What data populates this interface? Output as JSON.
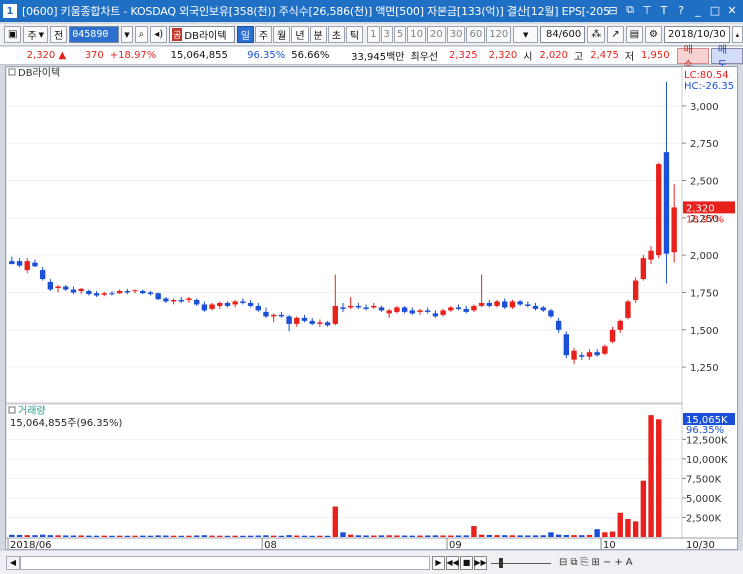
{
  "titlebar": {
    "number": "1",
    "title": "[0600] 키움종합차트 - KOSDAQ 외국인보유[358(천)] 주식수[26,586(천)] 액면[500] 자본금[133(억)] 결산[12월] EPS[-205"
  },
  "toolbar": {
    "type_label": "주",
    "jeon_label": "전",
    "stock_code": "045890",
    "gong_badge": "공",
    "stock_name": "DB라이텍",
    "periods": [
      {
        "label": "일",
        "selected": true
      },
      {
        "label": "주",
        "selected": false
      },
      {
        "label": "월",
        "selected": false
      },
      {
        "label": "년",
        "selected": false
      },
      {
        "label": "분",
        "selected": false
      },
      {
        "label": "초",
        "selected": false
      },
      {
        "label": "틱",
        "selected": false
      }
    ],
    "intervals": [
      "1",
      "3",
      "5",
      "10",
      "20",
      "30",
      "60",
      "120"
    ],
    "count": "84/600",
    "date": "2018/10/30"
  },
  "quote": {
    "price": "2,320",
    "change_arrow": "▲",
    "change": "370",
    "change_pct": "+18.97%",
    "volume": "15,064,855",
    "vol_ratio": "96.35%",
    "turnover_pct": "56.66%",
    "amount": "33,945백만",
    "best_bid_label": "최우선",
    "best_ask": "2,325",
    "best_bid": "2,320",
    "open_label": "시",
    "open": "2,020",
    "high_label": "고",
    "high": "2,475",
    "low_label": "저",
    "low": "1,950",
    "buy_label": "매수",
    "sell_label": "매도"
  },
  "price_panel": {
    "legend": "DB라이텍",
    "lc_label": "LC:80.54",
    "hc_label": "HC:-26.35",
    "current_price_tag": "2,320",
    "current_pct_tag": "18.97%"
  },
  "volume_panel": {
    "legend": "거래량",
    "summary": "15,064,855주(96.35%)",
    "current_tag": "15,065K",
    "current_pct_tag": "96.35%"
  },
  "chart_data": {
    "type": "candlestick",
    "price_axis": {
      "ticks": [
        "3,000",
        "2,750",
        "2,500",
        "2,250",
        "2,000",
        "1,750",
        "1,500",
        "1,250"
      ],
      "tick_values": [
        3000,
        2750,
        2500,
        2250,
        2000,
        1750,
        1500,
        1250
      ],
      "range": [
        1050,
        3180
      ]
    },
    "volume_axis": {
      "ticks": [
        "12,500K",
        "10,000K",
        "7,500K",
        "5,000K",
        "2,500K"
      ],
      "tick_values": [
        12500,
        10000,
        7500,
        5000,
        2500
      ],
      "range": [
        0,
        16000
      ]
    },
    "x_labels": [
      {
        "label": "2018/06",
        "index": 0
      },
      {
        "label": "08",
        "index": 33
      },
      {
        "label": "09",
        "index": 57
      },
      {
        "label": "10",
        "index": 77
      }
    ],
    "x_end_label": "10/30",
    "colors": {
      "up": "#e8211c",
      "down": "#1b4fd8"
    },
    "candles": [
      {
        "o": 1960,
        "h": 1990,
        "l": 1940,
        "c": 1940
      },
      {
        "o": 1960,
        "h": 1980,
        "l": 1920,
        "c": 1930
      },
      {
        "o": 1900,
        "h": 1980,
        "l": 1880,
        "c": 1960
      },
      {
        "o": 1950,
        "h": 1970,
        "l": 1920,
        "c": 1925
      },
      {
        "o": 1900,
        "h": 1920,
        "l": 1830,
        "c": 1840
      },
      {
        "o": 1820,
        "h": 1840,
        "l": 1760,
        "c": 1770
      },
      {
        "o": 1780,
        "h": 1800,
        "l": 1750,
        "c": 1790
      },
      {
        "o": 1790,
        "h": 1800,
        "l": 1760,
        "c": 1770
      },
      {
        "o": 1770,
        "h": 1790,
        "l": 1740,
        "c": 1750
      },
      {
        "o": 1760,
        "h": 1780,
        "l": 1740,
        "c": 1775
      },
      {
        "o": 1760,
        "h": 1770,
        "l": 1730,
        "c": 1740
      },
      {
        "o": 1745,
        "h": 1760,
        "l": 1720,
        "c": 1730
      },
      {
        "o": 1735,
        "h": 1755,
        "l": 1725,
        "c": 1745
      },
      {
        "o": 1745,
        "h": 1760,
        "l": 1730,
        "c": 1740
      },
      {
        "o": 1745,
        "h": 1770,
        "l": 1740,
        "c": 1760
      },
      {
        "o": 1760,
        "h": 1775,
        "l": 1740,
        "c": 1750
      },
      {
        "o": 1760,
        "h": 1770,
        "l": 1745,
        "c": 1765
      },
      {
        "o": 1760,
        "h": 1770,
        "l": 1740,
        "c": 1745
      },
      {
        "o": 1750,
        "h": 1760,
        "l": 1730,
        "c": 1740
      },
      {
        "o": 1745,
        "h": 1750,
        "l": 1700,
        "c": 1705
      },
      {
        "o": 1710,
        "h": 1720,
        "l": 1680,
        "c": 1690
      },
      {
        "o": 1690,
        "h": 1710,
        "l": 1670,
        "c": 1700
      },
      {
        "o": 1700,
        "h": 1720,
        "l": 1680,
        "c": 1690
      },
      {
        "o": 1700,
        "h": 1720,
        "l": 1680,
        "c": 1710
      },
      {
        "o": 1700,
        "h": 1710,
        "l": 1660,
        "c": 1670
      },
      {
        "o": 1670,
        "h": 1690,
        "l": 1620,
        "c": 1630
      },
      {
        "o": 1640,
        "h": 1680,
        "l": 1630,
        "c": 1670
      },
      {
        "o": 1660,
        "h": 1690,
        "l": 1640,
        "c": 1680
      },
      {
        "o": 1680,
        "h": 1690,
        "l": 1650,
        "c": 1660
      },
      {
        "o": 1670,
        "h": 1700,
        "l": 1650,
        "c": 1690
      },
      {
        "o": 1690,
        "h": 1710,
        "l": 1670,
        "c": 1680
      },
      {
        "o": 1680,
        "h": 1700,
        "l": 1650,
        "c": 1660
      },
      {
        "o": 1660,
        "h": 1680,
        "l": 1620,
        "c": 1630
      },
      {
        "o": 1620,
        "h": 1650,
        "l": 1580,
        "c": 1590
      },
      {
        "o": 1590,
        "h": 1610,
        "l": 1550,
        "c": 1600
      },
      {
        "o": 1600,
        "h": 1620,
        "l": 1580,
        "c": 1590
      },
      {
        "o": 1590,
        "h": 1600,
        "l": 1490,
        "c": 1540
      },
      {
        "o": 1540,
        "h": 1590,
        "l": 1520,
        "c": 1580
      },
      {
        "o": 1580,
        "h": 1600,
        "l": 1550,
        "c": 1560
      },
      {
        "o": 1560,
        "h": 1580,
        "l": 1530,
        "c": 1540
      },
      {
        "o": 1540,
        "h": 1570,
        "l": 1520,
        "c": 1550
      },
      {
        "o": 1550,
        "h": 1560,
        "l": 1520,
        "c": 1530
      },
      {
        "o": 1540,
        "h": 1870,
        "l": 1530,
        "c": 1660
      },
      {
        "o": 1650,
        "h": 1680,
        "l": 1620,
        "c": 1640
      },
      {
        "o": 1650,
        "h": 1720,
        "l": 1640,
        "c": 1660
      },
      {
        "o": 1660,
        "h": 1680,
        "l": 1640,
        "c": 1650
      },
      {
        "o": 1650,
        "h": 1670,
        "l": 1630,
        "c": 1640
      },
      {
        "o": 1650,
        "h": 1680,
        "l": 1640,
        "c": 1660
      },
      {
        "o": 1650,
        "h": 1660,
        "l": 1620,
        "c": 1630
      },
      {
        "o": 1610,
        "h": 1640,
        "l": 1580,
        "c": 1630
      },
      {
        "o": 1620,
        "h": 1660,
        "l": 1610,
        "c": 1650
      },
      {
        "o": 1650,
        "h": 1660,
        "l": 1610,
        "c": 1620
      },
      {
        "o": 1630,
        "h": 1650,
        "l": 1600,
        "c": 1610
      },
      {
        "o": 1620,
        "h": 1640,
        "l": 1600,
        "c": 1630
      },
      {
        "o": 1630,
        "h": 1650,
        "l": 1610,
        "c": 1620
      },
      {
        "o": 1610,
        "h": 1630,
        "l": 1580,
        "c": 1590
      },
      {
        "o": 1600,
        "h": 1640,
        "l": 1590,
        "c": 1630
      },
      {
        "o": 1630,
        "h": 1660,
        "l": 1620,
        "c": 1650
      },
      {
        "o": 1650,
        "h": 1670,
        "l": 1630,
        "c": 1640
      },
      {
        "o": 1640,
        "h": 1660,
        "l": 1610,
        "c": 1620
      },
      {
        "o": 1630,
        "h": 1670,
        "l": 1620,
        "c": 1660
      },
      {
        "o": 1660,
        "h": 1870,
        "l": 1650,
        "c": 1680
      },
      {
        "o": 1680,
        "h": 1700,
        "l": 1650,
        "c": 1660
      },
      {
        "o": 1660,
        "h": 1700,
        "l": 1650,
        "c": 1690
      },
      {
        "o": 1690,
        "h": 1710,
        "l": 1640,
        "c": 1650
      },
      {
        "o": 1650,
        "h": 1700,
        "l": 1640,
        "c": 1690
      },
      {
        "o": 1690,
        "h": 1700,
        "l": 1660,
        "c": 1670
      },
      {
        "o": 1670,
        "h": 1690,
        "l": 1650,
        "c": 1660
      },
      {
        "o": 1660,
        "h": 1680,
        "l": 1630,
        "c": 1640
      },
      {
        "o": 1650,
        "h": 1660,
        "l": 1620,
        "c": 1630
      },
      {
        "o": 1630,
        "h": 1640,
        "l": 1580,
        "c": 1590
      },
      {
        "o": 1560,
        "h": 1580,
        "l": 1480,
        "c": 1500
      },
      {
        "o": 1470,
        "h": 1490,
        "l": 1310,
        "c": 1330
      },
      {
        "o": 1300,
        "h": 1380,
        "l": 1270,
        "c": 1360
      },
      {
        "o": 1330,
        "h": 1350,
        "l": 1300,
        "c": 1320
      },
      {
        "o": 1320,
        "h": 1370,
        "l": 1300,
        "c": 1350
      },
      {
        "o": 1350,
        "h": 1370,
        "l": 1320,
        "c": 1330
      },
      {
        "o": 1340,
        "h": 1400,
        "l": 1330,
        "c": 1390
      },
      {
        "o": 1420,
        "h": 1520,
        "l": 1410,
        "c": 1500
      },
      {
        "o": 1500,
        "h": 1570,
        "l": 1480,
        "c": 1560
      },
      {
        "o": 1580,
        "h": 1700,
        "l": 1570,
        "c": 1690
      },
      {
        "o": 1700,
        "h": 1850,
        "l": 1680,
        "c": 1830
      },
      {
        "o": 1840,
        "h": 2000,
        "l": 1830,
        "c": 1980
      },
      {
        "o": 1970,
        "h": 2060,
        "l": 1940,
        "c": 2030
      },
      {
        "o": 2000,
        "h": 2620,
        "l": 1980,
        "c": 2610
      },
      {
        "o": 2690,
        "h": 3160,
        "l": 1810,
        "c": 2010
      },
      {
        "o": 2020,
        "h": 2475,
        "l": 1950,
        "c": 2320
      }
    ],
    "volumes": [
      280,
      260,
      240,
      230,
      300,
      240,
      220,
      200,
      190,
      200,
      180,
      170,
      170,
      160,
      170,
      160,
      170,
      180,
      170,
      210,
      190,
      170,
      160,
      170,
      200,
      230,
      180,
      170,
      160,
      170,
      160,
      170,
      190,
      220,
      170,
      160,
      240,
      190,
      170,
      160,
      170,
      160,
      3900,
      600,
      300,
      220,
      200,
      190,
      210,
      220,
      200,
      190,
      180,
      190,
      200,
      210,
      200,
      190,
      200,
      210,
      1400,
      300,
      260,
      240,
      230,
      220,
      210,
      200,
      210,
      220,
      600,
      300,
      260,
      240,
      230,
      260,
      1000,
      600,
      700,
      3100,
      2300,
      2000,
      7200,
      15600,
      15065
    ]
  }
}
